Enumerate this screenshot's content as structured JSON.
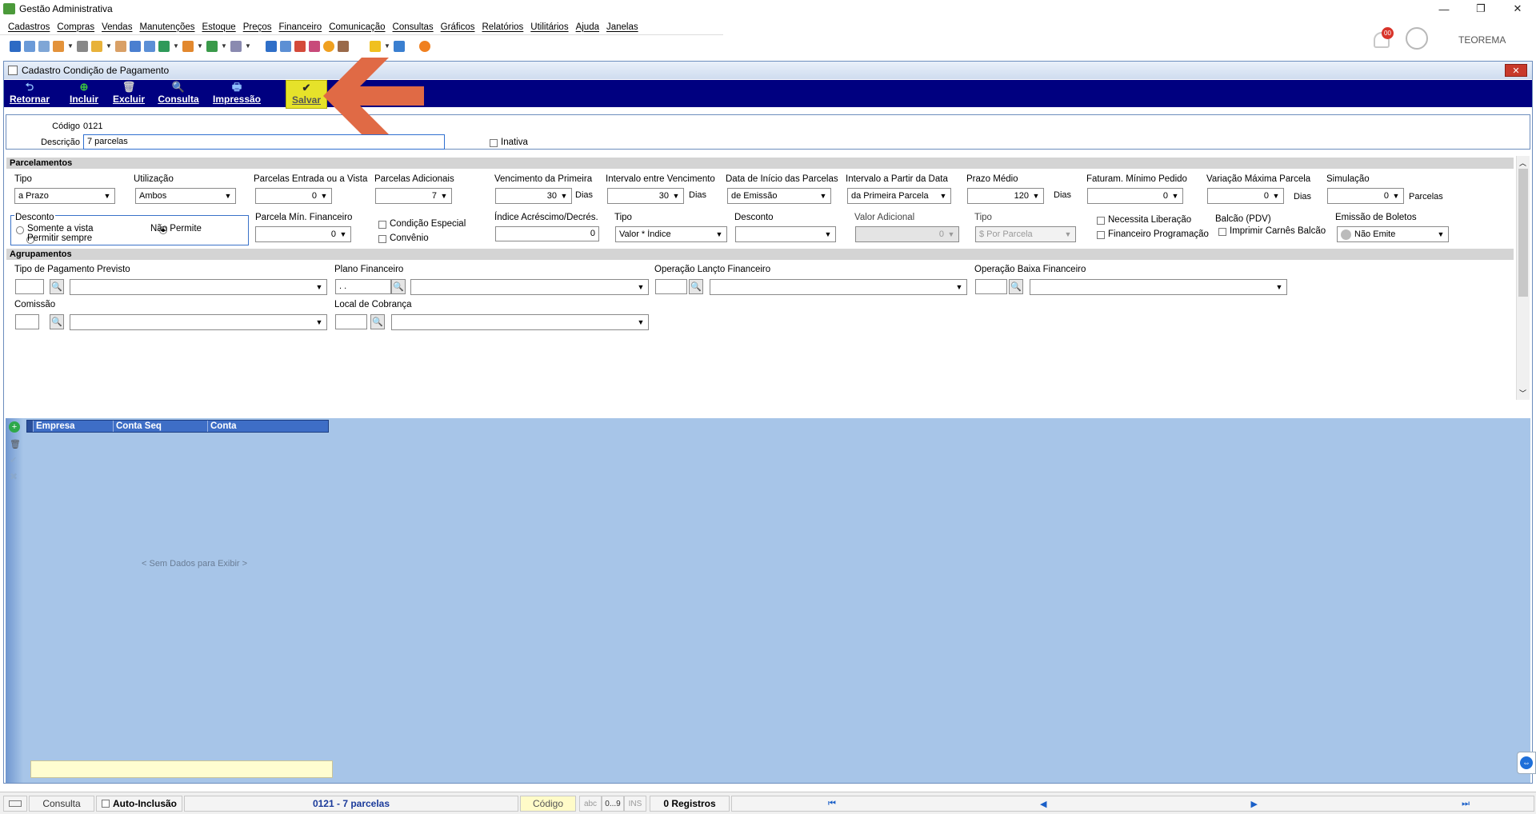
{
  "window": {
    "title": "Gestão Administrativa",
    "minimize": "—",
    "restore": "❐",
    "close": "✕"
  },
  "menu": [
    "Cadastros",
    "Compras",
    "Vendas",
    "Manutenções",
    "Estoque",
    "Preços",
    "Financeiro",
    "Comunicação",
    "Consultas",
    "Gráficos",
    "Relatórios",
    "Utilitários",
    "Ajuda",
    "Janelas"
  ],
  "user": {
    "name": "TEOREMA",
    "notifications": "00"
  },
  "form": {
    "title": "Cadastro Condição de Pagamento",
    "close": "✕",
    "actions": {
      "back": "Retornar",
      "add": "Incluir",
      "delete": "Excluir",
      "query": "Consulta",
      "print": "Impressão",
      "save": "Salvar"
    },
    "code_label": "Código",
    "code_value": "0121",
    "desc_label": "Descrição",
    "desc_value": "7 parcelas",
    "inactive_label": "Inativa"
  },
  "parcelamentos": {
    "section": "Parcelamentos",
    "tipo": {
      "label": "Tipo",
      "value": "a Prazo"
    },
    "utilizacao": {
      "label": "Utilização",
      "value": "Ambos"
    },
    "entrada": {
      "label": "Parcelas Entrada ou a Vista",
      "value": "0"
    },
    "adicionais": {
      "label": "Parcelas Adicionais",
      "value": "7"
    },
    "venc_primeira": {
      "label": "Vencimento da Primeira",
      "value": "30",
      "unit": "Dias"
    },
    "intervalo": {
      "label": "Intervalo entre Vencimento",
      "value": "30",
      "unit": "Dias"
    },
    "data_inicio": {
      "label": "Data de Início das Parcelas",
      "value": "de Emissão"
    },
    "intervalo_partir": {
      "label": "Intervalo a Partir da Data",
      "value": "da Primeira Parcela"
    },
    "prazo_medio": {
      "label": "Prazo Médio",
      "value": "120",
      "unit": "Dias"
    },
    "faturam_min": {
      "label": "Faturam. Mínimo Pedido",
      "value": "0"
    },
    "variacao": {
      "label": "Variação Máxima Parcela",
      "value": "0",
      "unit": "Dias"
    },
    "simulacao": {
      "label": "Simulação",
      "value": "0",
      "unit": "Parcelas"
    },
    "desconto_group": {
      "label": "Desconto",
      "opt1": "Somente a vista",
      "opt2": "Permitir sempre",
      "opt3": "Não Permite"
    },
    "parcela_min": {
      "label": "Parcela Mín. Financeiro",
      "value": "0"
    },
    "cond_especial": "Condição Especial",
    "convenio": "Convênio",
    "indice": {
      "label": "Índice Acréscimo/Decrés.",
      "value": "0"
    },
    "tipo2": {
      "label": "Tipo",
      "value": "Valor * Índice"
    },
    "desconto2": {
      "label": "Desconto",
      "value": ""
    },
    "valor_adicional": {
      "label": "Valor Adicional",
      "value": "0"
    },
    "tipo3": {
      "label": "Tipo",
      "value": "$ Por Parcela"
    },
    "necessita": "Necessita Liberação",
    "fin_prog": "Financeiro Programação",
    "balcao": {
      "label": "Balcão (PDV)",
      "check": "Imprimir Carnês Balcão"
    },
    "boletos": {
      "label": "Emissão de Boletos",
      "value": "Não Emite"
    }
  },
  "agrupamentos": {
    "section": "Agrupamentos",
    "tipo_pag": "Tipo de Pagamento Previsto",
    "plano": {
      "label": "Plano Financeiro",
      "value": " .  ."
    },
    "op_lanc": "Operação Lançto Financeiro",
    "op_baixa": "Operação Baixa Financeiro",
    "comissao": "Comissão",
    "local": "Local de Cobrança"
  },
  "grid": {
    "columns": [
      "Empresa",
      "Conta Seq",
      "Conta"
    ],
    "empty": "< Sem Dados para Exibir >"
  },
  "status": {
    "mode": "Consulta",
    "auto": "Auto-Inclusão",
    "record": "0121 - 7 parcelas",
    "field": "Código",
    "abc": "abc",
    "num": "0...9",
    "ins": "INS",
    "count": "0 Registros"
  },
  "colors": {
    "action_bar": "#000080",
    "save_highlight": "#e6e22a",
    "arrow": "#e06a45",
    "grid_bg": "#a7c5e8"
  }
}
